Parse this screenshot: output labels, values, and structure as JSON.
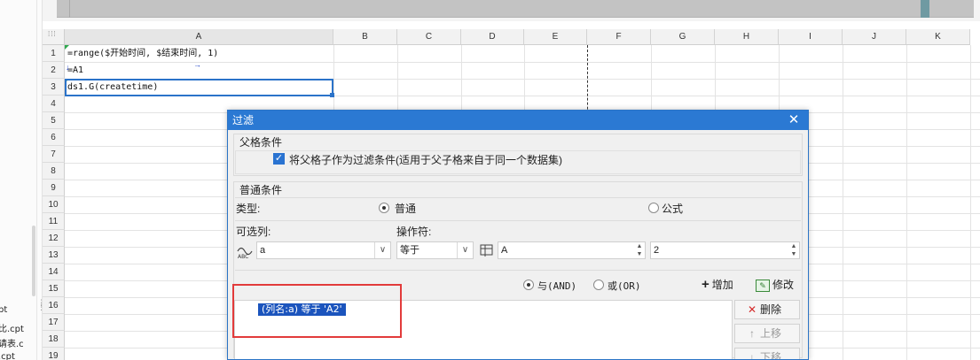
{
  "left_panel": {
    "items": [
      "pt",
      "比.cpt",
      "请表.c",
      ".cpt"
    ]
  },
  "sheet": {
    "columns": [
      "A",
      "B",
      "C",
      "D",
      "E",
      "F",
      "G",
      "H",
      "I",
      "J",
      "K"
    ],
    "selected_column": "A",
    "rows": [
      "1",
      "2",
      "3",
      "4",
      "5",
      "6",
      "7",
      "8",
      "9",
      "10",
      "11",
      "12",
      "13",
      "14",
      "15",
      "16",
      "17",
      "18",
      "19"
    ],
    "cells": {
      "A1": "=range($开始时间, $结束时间, 1)",
      "A2": "=A1",
      "A3": "ds1.G(createtime)"
    }
  },
  "dialog": {
    "title": "过滤",
    "parent_condition": {
      "title": "父格条件",
      "checkbox_label": "将父格子作为过滤条件(适用于父子格来自于同一个数据集)",
      "checked": true
    },
    "normal_condition": {
      "title": "普通条件",
      "type_label": "类型:",
      "type_options": [
        "普通",
        "公式"
      ],
      "type_selected": "普通",
      "column_label": "可选列:",
      "operator_label": "操作符:",
      "column_value": "a",
      "operator_value": "等于",
      "value_text": "A",
      "value_number": "2",
      "logic_options": [
        "与(AND)",
        "或(OR)"
      ],
      "logic_selected": "与(AND)",
      "add_button": "增加",
      "modify_button": "修改"
    },
    "conditions": [
      "(列名:a) 等于 'A2'"
    ],
    "side_buttons": {
      "delete": "删除",
      "move_up": "上移",
      "move_down": "下移"
    }
  },
  "colors": {
    "dialog_title_bg": "#2b79d3",
    "selection": "#2b73c9",
    "annotation": "#e23b3b",
    "list_highlight": "#1b54bd"
  }
}
